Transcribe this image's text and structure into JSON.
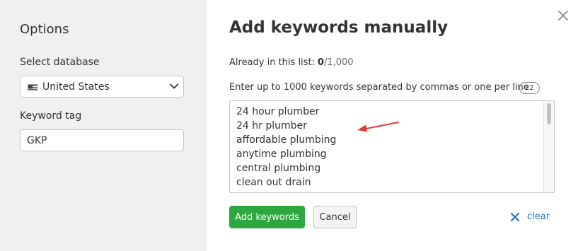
{
  "options": {
    "title": "Options",
    "database_label": "Select database",
    "database_value": "United States",
    "tag_label": "Keyword tag",
    "tag_value": "GKP"
  },
  "main": {
    "title": "Add keywords manually",
    "already_label": "Already in this list:",
    "already_count": "0",
    "already_total": "/1,000",
    "instructions": "Enter up to 1000 keywords separated by commas or one per line",
    "keyword_count": "22",
    "keywords": [
      "24 hour plumber",
      "24 hr plumber",
      "affordable plumbing",
      "anytime plumbing",
      "central plumbing",
      "clean out drain"
    ]
  },
  "actions": {
    "add_label": "Add keywords",
    "cancel_label": "Cancel",
    "clear_label": "clear"
  },
  "colors": {
    "options_background": "#f0f0f1",
    "primary_button": "#2fa741",
    "link": "#1a73c4",
    "annotation_arrow": "#e53935"
  },
  "icons": {
    "close": "close-icon",
    "flag": "us-flag-icon",
    "dropdown": "chevron-down-icon",
    "clear": "clear-x-icon",
    "annotation": "red-arrow-annotation"
  }
}
